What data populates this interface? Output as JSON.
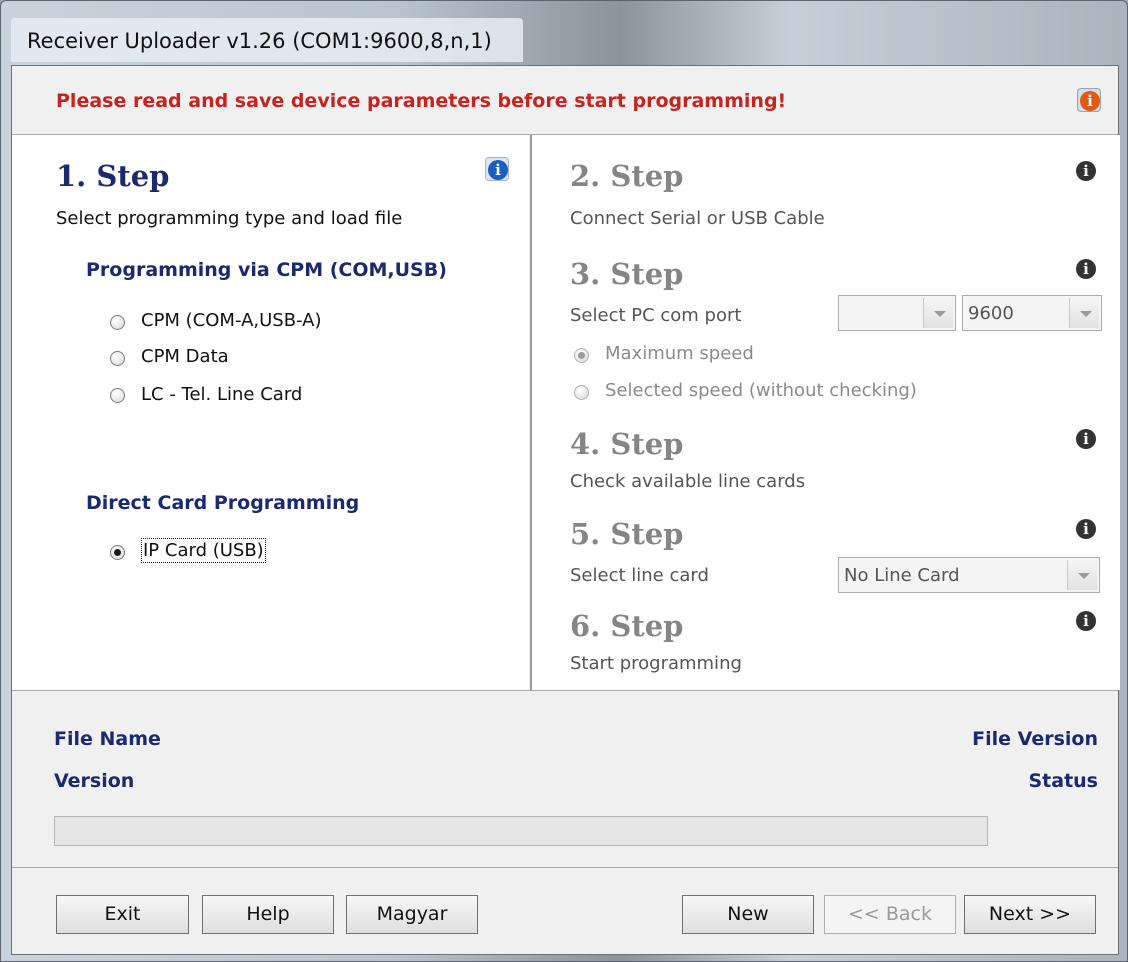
{
  "window": {
    "title": "Receiver Uploader v1.26 (COM1:9600,8,n,1)"
  },
  "warning": {
    "text": "Please read and save device parameters before start programming!"
  },
  "step1": {
    "title": "1. Step",
    "desc": "Select programming type and load file",
    "cpm_heading": "Programming via CPM (COM,USB)",
    "options": [
      "CPM (COM-A,USB-A)",
      "CPM Data",
      "LC - Tel. Line Card"
    ],
    "direct_heading": "Direct Card Programming",
    "direct_option": "IP Card (USB)"
  },
  "step2": {
    "title": "2. Step",
    "desc": "Connect Serial or USB Cable"
  },
  "step3": {
    "title": "3. Step",
    "desc": "Select PC com port",
    "port_value": "",
    "speed_value": "9600",
    "max_speed": "Maximum speed",
    "selected_speed": "Selected speed (without checking)"
  },
  "step4": {
    "title": "4. Step",
    "desc": "Check available line cards"
  },
  "step5": {
    "title": "5. Step",
    "desc": "Select line card",
    "line_card_value": "No Line Card"
  },
  "step6": {
    "title": "6. Step",
    "desc": "Start programming"
  },
  "info": {
    "file_name": "File Name",
    "file_version": "File Version",
    "version": "Version",
    "status": "Status",
    "progress": 0
  },
  "buttons": {
    "exit": "Exit",
    "help": "Help",
    "language": "Magyar",
    "new": "New",
    "back": "<< Back",
    "next": "Next >>"
  },
  "colors": {
    "warning": "#c8231e",
    "heading": "#1a2a6c",
    "info_orange": "#e25a10",
    "info_blue": "#1b5fc4"
  }
}
